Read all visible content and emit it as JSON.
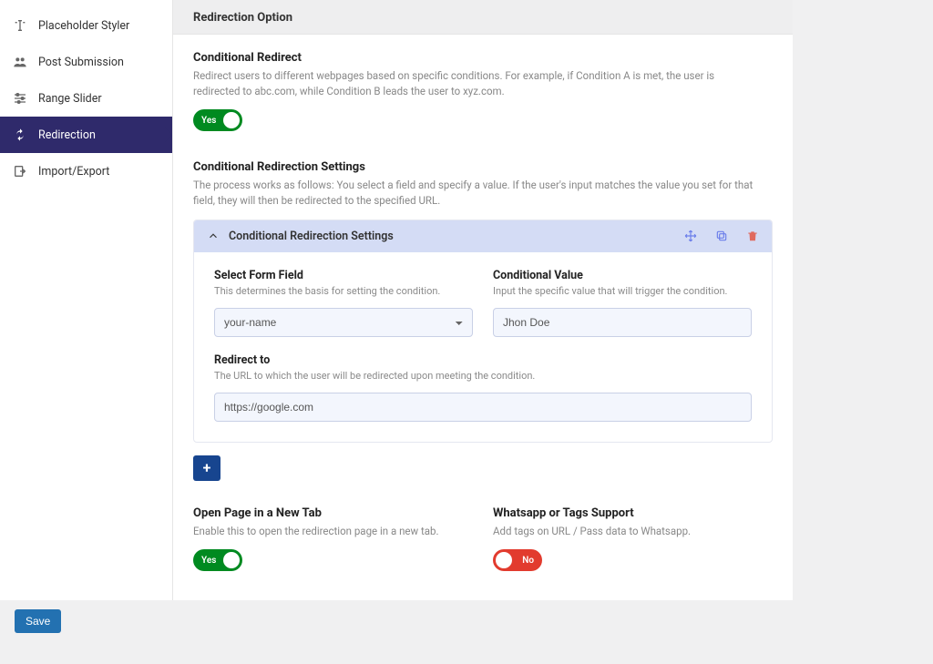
{
  "sidebar": {
    "items": [
      {
        "label": "Placeholder Styler"
      },
      {
        "label": "Post Submission"
      },
      {
        "label": "Range Slider"
      },
      {
        "label": "Redirection"
      },
      {
        "label": "Import/Export"
      }
    ]
  },
  "header": {
    "title": "Redirection Option"
  },
  "conditional_redirect": {
    "title": "Conditional Redirect",
    "desc": "Redirect users to different webpages based on specific conditions. For example, if Condition A is met, the user is redirected to abc.com, while Condition B leads the user to xyz.com.",
    "toggle_label": "Yes"
  },
  "conditional_settings": {
    "title": "Conditional Redirection Settings",
    "desc": "The process works as follows: You select a field and specify a value. If the user's input matches the value you set for that field, they will then be redirected to the specified URL.",
    "panel_title": "Conditional Redirection Settings",
    "select_field": {
      "label": "Select Form Field",
      "desc": "This determines the basis for setting the condition.",
      "value": "your-name"
    },
    "conditional_value": {
      "label": "Conditional Value",
      "desc": "Input the specific value that will trigger the condition.",
      "value": "Jhon Doe"
    },
    "redirect_to": {
      "label": "Redirect to",
      "desc": "The URL to which the user will be redirected upon meeting the condition.",
      "value": "https://google.com"
    }
  },
  "new_tab": {
    "title": "Open Page in a New Tab",
    "desc": "Enable this to open the redirection page in a new tab.",
    "toggle_label": "Yes"
  },
  "whatsapp": {
    "title": "Whatsapp or Tags Support",
    "desc": "Add tags on URL / Pass data to Whatsapp.",
    "toggle_label": "No"
  },
  "buttons": {
    "save": "Save",
    "add": "+"
  }
}
